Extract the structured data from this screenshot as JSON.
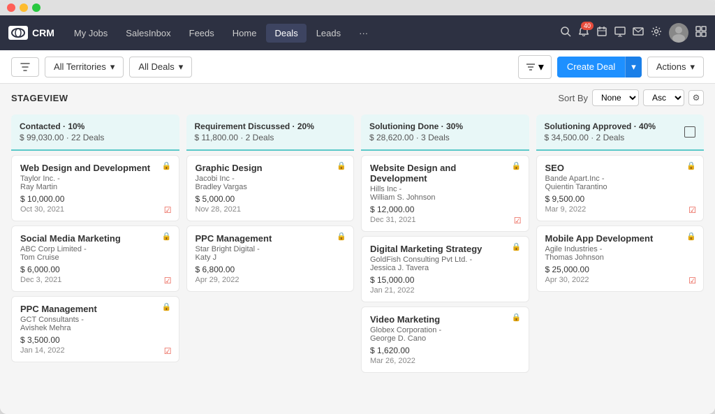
{
  "window": {
    "title": "CRM"
  },
  "navbar": {
    "logo_text": "CRM",
    "items": [
      {
        "label": "My Jobs",
        "active": false
      },
      {
        "label": "SalesInbox",
        "active": false
      },
      {
        "label": "Feeds",
        "active": false
      },
      {
        "label": "Home",
        "active": false
      },
      {
        "label": "Deals",
        "active": true
      },
      {
        "label": "Leads",
        "active": false
      },
      {
        "label": "···",
        "active": false
      }
    ],
    "notification_badge": "40"
  },
  "toolbar": {
    "filter_label": "",
    "territory_label": "All Territories",
    "deals_label": "All Deals",
    "create_deal_label": "Create Deal",
    "actions_label": "Actions"
  },
  "stageview": {
    "label": "STAGEVIEW",
    "sort_by": "Sort By",
    "sort_none": "None",
    "sort_asc": "Asc"
  },
  "columns": [
    {
      "title": "Contacted · 10%",
      "subtitle": "$ 99,030.00 · 22 Deals",
      "cards": [
        {
          "title": "Web Design and Development",
          "company": "Taylor Inc. -",
          "contact": "Ray Martin",
          "amount": "$ 10,000.00",
          "date": "Oct 30, 2021",
          "locked": true,
          "checked": true
        },
        {
          "title": "Social Media Marketing",
          "company": "ABC Corp Limited -",
          "contact": "Tom Cruise",
          "amount": "$ 6,000.00",
          "date": "Dec 3, 2021",
          "locked": true,
          "checked": true
        },
        {
          "title": "PPC Management",
          "company": "GCT Consultants -",
          "contact": "Avishek Mehra",
          "amount": "$ 3,500.00",
          "date": "Jan 14, 2022",
          "locked": true,
          "checked": true
        }
      ]
    },
    {
      "title": "Requirement Discussed · 20%",
      "subtitle": "$ 11,800.00 · 2 Deals",
      "cards": [
        {
          "title": "Graphic Design",
          "company": "Jacobi Inc -",
          "contact": "Bradley Vargas",
          "amount": "$ 5,000.00",
          "date": "Nov 28, 2021",
          "locked": true,
          "checked": false
        },
        {
          "title": "PPC Management",
          "company": "Star Bright Digital -",
          "contact": "Katy J",
          "amount": "$ 6,800.00",
          "date": "Apr 29, 2022",
          "locked": true,
          "checked": false
        }
      ]
    },
    {
      "title": "Solutioning Done · 30%",
      "subtitle": "$ 28,620.00 · 3 Deals",
      "cards": [
        {
          "title": "Website Design and Development",
          "company": "Hills Inc -",
          "contact": "William S. Johnson",
          "amount": "$ 12,000.00",
          "date": "Dec 31, 2021",
          "locked": true,
          "checked": true
        },
        {
          "title": "Digital Marketing Strategy",
          "company": "GoldFish Consulting Pvt Ltd. -",
          "contact": "Jessica J. Tavera",
          "amount": "$ 15,000.00",
          "date": "Jan 21, 2022",
          "locked": true,
          "checked": false
        },
        {
          "title": "Video Marketing",
          "company": "Globex Corporation -",
          "contact": "George D. Cano",
          "amount": "$ 1,620.00",
          "date": "Mar 26, 2022",
          "locked": true,
          "checked": false
        }
      ]
    },
    {
      "title": "Solutioning Approved · 40%",
      "subtitle": "$ 34,500.00 · 2 Deals",
      "cards": [
        {
          "title": "SEO",
          "company": "Bande Apart.Inc -",
          "contact": "Quientin Tarantino",
          "amount": "$ 9,500.00",
          "date": "Mar 9, 2022",
          "locked": true,
          "checked": true
        },
        {
          "title": "Mobile App Development",
          "company": "Agile Industries -",
          "contact": "Thomas Johnson",
          "amount": "$ 25,000.00",
          "date": "Apr 30, 2022",
          "locked": true,
          "checked": true
        }
      ]
    }
  ]
}
